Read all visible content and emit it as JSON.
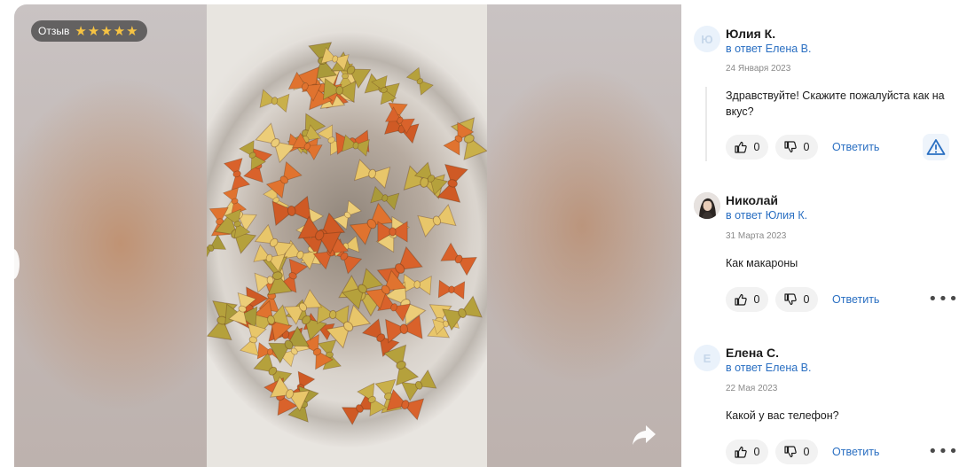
{
  "review_badge": {
    "label": "Отзыв",
    "rating": 5
  },
  "icons": {
    "star": "star-icon",
    "share": "share-icon",
    "like": "thumb-up-icon",
    "dislike": "thumb-down-icon",
    "report": "warning-icon",
    "more": "more-icon"
  },
  "colors": {
    "link": "#2a6fc2",
    "star": "#f6c343"
  },
  "comments": [
    {
      "avatar_letter": "Ю",
      "author": "Юлия К.",
      "reply_to": "в ответ Елена В.",
      "date": "24 Января 2023",
      "text": "Здравствуйте! Скажите пожалуйста как на вкус?",
      "likes": "0",
      "dislikes": "0",
      "reply_label": "Ответить"
    },
    {
      "avatar_letter": "",
      "author": "Николай",
      "reply_to": "в ответ Юлия К.",
      "date": "31 Марта 2023",
      "text": "Как макароны",
      "likes": "0",
      "dislikes": "0",
      "reply_label": "Ответить"
    },
    {
      "avatar_letter": "Е",
      "author": "Елена С.",
      "reply_to": "в ответ Елена В.",
      "date": "22 Мая 2023",
      "text": "Какой у вас телефон?",
      "likes": "0",
      "dislikes": "0",
      "reply_label": "Ответить"
    }
  ]
}
